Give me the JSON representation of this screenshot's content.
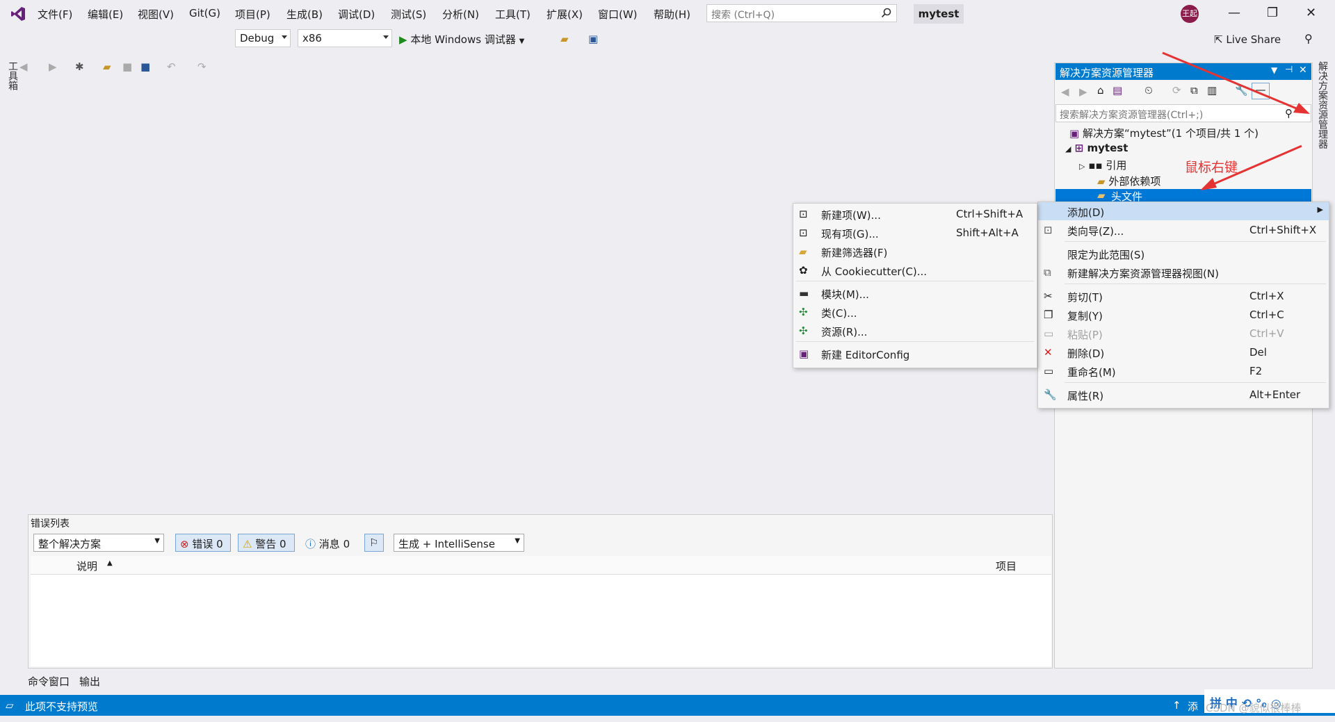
{
  "menu": [
    "文件(F)",
    "编辑(E)",
    "视图(V)",
    "Git(G)",
    "项目(P)",
    "生成(B)",
    "调试(D)",
    "测试(S)",
    "分析(N)",
    "工具(T)",
    "扩展(X)",
    "窗口(W)",
    "帮助(H)"
  ],
  "search": {
    "placeholder": "搜索 (Ctrl+Q)"
  },
  "project_name": "mytest",
  "user_avatar": "王起",
  "toolbar": {
    "config": "Debug",
    "platform": "x86",
    "run_label": "本地 Windows 调试器",
    "live_share": "Live Share"
  },
  "toolbox_tab": "工具箱",
  "solution_explorer": {
    "title": "解决方案资源管理器",
    "search_placeholder": "搜索解决方案资源管理器(Ctrl+;)",
    "tree": [
      {
        "label": "解决方案“mytest”(1 个项目/共 1 个)"
      },
      {
        "label": "mytest"
      },
      {
        "label": "引用"
      },
      {
        "label": "外部依赖项"
      },
      {
        "label": "头文件"
      }
    ],
    "side_tab": "解决方案资源管理器"
  },
  "annotation": "鼠标右键",
  "context_menu": [
    {
      "label": "添加(D)",
      "shortcut": ""
    },
    {
      "label": "类向导(Z)...",
      "shortcut": "Ctrl+Shift+X"
    },
    {
      "label": "限定为此范围(S)",
      "shortcut": ""
    },
    {
      "label": "新建解决方案资源管理器视图(N)",
      "shortcut": ""
    },
    {
      "label": "剪切(T)",
      "shortcut": "Ctrl+X"
    },
    {
      "label": "复制(Y)",
      "shortcut": "Ctrl+C"
    },
    {
      "label": "粘贴(P)",
      "shortcut": "Ctrl+V"
    },
    {
      "label": "删除(D)",
      "shortcut": "Del"
    },
    {
      "label": "重命名(M)",
      "shortcut": "F2"
    },
    {
      "label": "属性(R)",
      "shortcut": "Alt+Enter"
    }
  ],
  "submenu": [
    {
      "label": "新建项(W)...",
      "shortcut": "Ctrl+Shift+A"
    },
    {
      "label": "现有项(G)...",
      "shortcut": "Shift+Alt+A"
    },
    {
      "label": "新建筛选器(F)",
      "shortcut": ""
    },
    {
      "label": "从 Cookiecutter(C)...",
      "shortcut": ""
    },
    {
      "label": "模块(M)...",
      "shortcut": ""
    },
    {
      "label": "类(C)...",
      "shortcut": ""
    },
    {
      "label": "资源(R)...",
      "shortcut": ""
    },
    {
      "label": "新建 EditorConfig",
      "shortcut": ""
    }
  ],
  "error_list": {
    "title": "错误列表",
    "scope": "整个解决方案",
    "errors": "错误 0",
    "warnings": "警告 0",
    "messages": "消息 0",
    "build_filter": "生成 + IntelliSense",
    "col_desc": "说明",
    "col_project": "项目"
  },
  "bottom_tabs": [
    "命令窗口",
    "输出"
  ],
  "status": {
    "text": "此项不支持预览",
    "right_text": "添"
  },
  "watermark": "CSDN @貌似很棒棒",
  "ime": "拼 中 ⟲ °₀ ◎"
}
